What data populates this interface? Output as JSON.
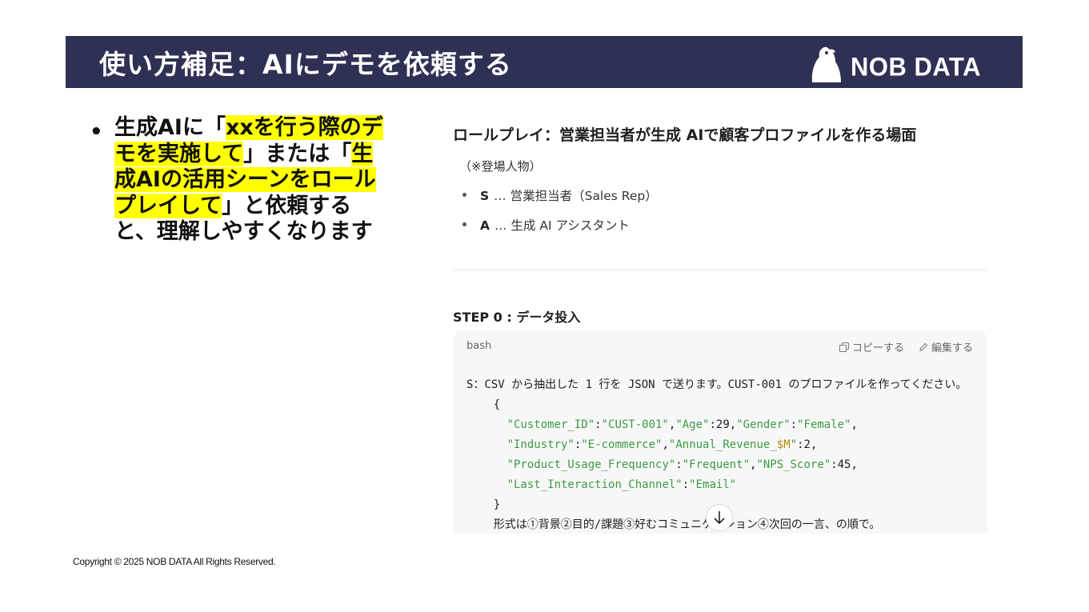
{
  "header": {
    "title": "使い方補足：AIにデモを依頼する",
    "logo_text": "NOB DATA",
    "colors": {
      "band": "#2e3054",
      "text": "#ffffff"
    }
  },
  "bullet": {
    "parts": [
      {
        "text": "生成AIに「",
        "highlight": false
      },
      {
        "text": "xxを行う際のデモを実施して",
        "highlight": true
      },
      {
        "text": "」または「",
        "highlight": false
      },
      {
        "text": "生成AIの活用シーンをロールプレイして",
        "highlight": true
      },
      {
        "text": "」と依頼すると、理解しやすくなります",
        "highlight": false
      }
    ],
    "highlight_color": "#ffff00"
  },
  "screenshot": {
    "role_title": "ロールプレイ：営業担当者が生成 AIで顧客プロファイルを作る場面",
    "cast_note": "（※登場人物）",
    "cast": [
      {
        "key": "S",
        "desc": "… 営業担当者（Sales Rep）"
      },
      {
        "key": "A",
        "desc": "… 生成 AI アシスタント"
      }
    ],
    "step_title": "STEP 0 : データ投入",
    "code_block": {
      "lang": "bash",
      "copy_label": "コピーする",
      "edit_label": "編集する",
      "line1": "S：CSV から抽出した 1 行を JSON で送ります。CUST-001 のプロファイルを作ってください。",
      "open_brace": "{",
      "close_brace": "}",
      "last_line": "形式は①背景②目的/課題③好むコミュニケーション④次回の一言、の順で。",
      "json": {
        "customer_id_key": "\"Customer_ID\"",
        "customer_id_val": "\"CUST-001\"",
        "age_key": "\"Age\"",
        "age_val": "29",
        "gender_key": "\"Gender\"",
        "gender_val": "\"Female\"",
        "industry_key": "\"Industry\"",
        "industry_val": "\"E-commerce\"",
        "revenue_key_a": "\"Annual_Revenue_",
        "revenue_key_b": "$M",
        "revenue_key_c": "\"",
        "revenue_val": "2",
        "usage_key": "\"Product_Usage_Frequency\"",
        "usage_val": "\"Frequent\"",
        "nps_key": "\"NPS_Score\"",
        "nps_val": "45",
        "channel_key": "\"Last_Interaction_Channel\"",
        "channel_val": "\"Email\""
      }
    }
  },
  "footer": {
    "copyright": "Copyright © 2025 NOB DATA All Rights Reserved."
  }
}
